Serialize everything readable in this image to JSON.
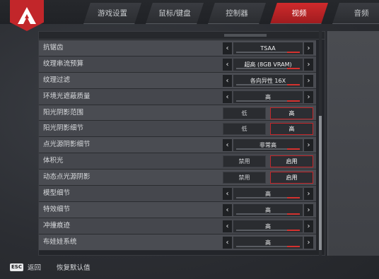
{
  "header": {
    "tabs": [
      {
        "label": "游戏设置",
        "active": false
      },
      {
        "label": "鼠标/键盘",
        "active": false
      },
      {
        "label": "控制器",
        "active": false
      },
      {
        "label": "视频",
        "active": true
      },
      {
        "label": "音频",
        "active": false
      }
    ]
  },
  "settings": [
    {
      "label": "抗锯齿",
      "type": "selector",
      "value": "TSAA"
    },
    {
      "label": "纹理串流预算",
      "type": "selector",
      "value": "超高 (8GB VRAM)"
    },
    {
      "label": "纹理过滤",
      "type": "selector",
      "value": "各向异性 16X"
    },
    {
      "label": "环境光遮蔽质量",
      "type": "selector",
      "value": "高"
    },
    {
      "label": "阳光阴影范围",
      "type": "toggle",
      "options": [
        "低",
        "高"
      ],
      "selected": 1
    },
    {
      "label": "阳光阴影细节",
      "type": "toggle",
      "options": [
        "低",
        "高"
      ],
      "selected": 1
    },
    {
      "label": "点光源阴影细节",
      "type": "selector",
      "value": "非常高"
    },
    {
      "label": "体积光",
      "type": "toggle",
      "options": [
        "禁用",
        "启用"
      ],
      "selected": 1
    },
    {
      "label": "动态点光源阴影",
      "type": "toggle",
      "options": [
        "禁用",
        "启用"
      ],
      "selected": 1
    },
    {
      "label": "模型细节",
      "type": "selector",
      "value": "高"
    },
    {
      "label": "特效细节",
      "type": "selector",
      "value": "高"
    },
    {
      "label": "冲撞痕迹",
      "type": "selector",
      "value": "高"
    },
    {
      "label": "布娃娃系统",
      "type": "selector",
      "value": "高"
    }
  ],
  "footer": {
    "esc_key": "ESC",
    "back_label": "返回",
    "reset_label": "恢复默认值"
  },
  "colors": {
    "accent": "#c2262a",
    "panel": "#4a4c52"
  }
}
